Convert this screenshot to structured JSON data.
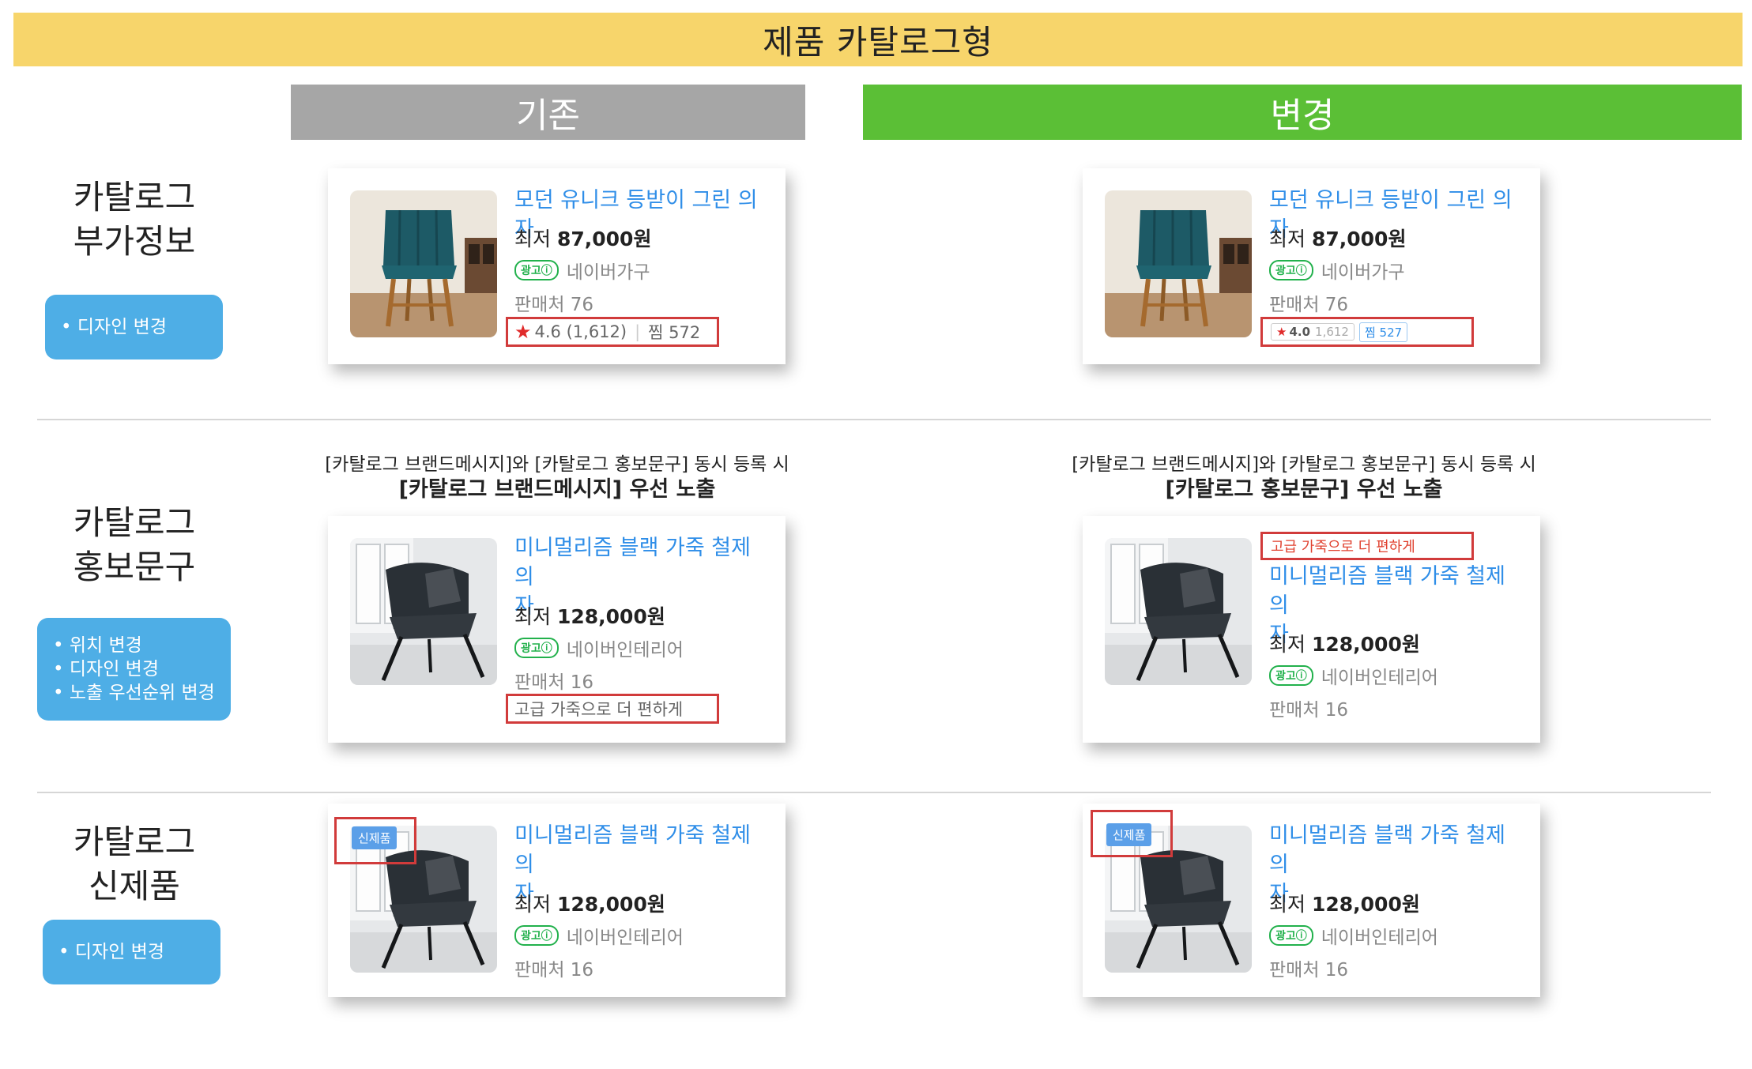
{
  "banner": "제품 카탈로그형",
  "columns": {
    "old": "기존",
    "new": "변경"
  },
  "rows": [
    {
      "title_line1": "카탈로그",
      "title_line2": "부가정보",
      "changes": [
        "디자인 변경"
      ]
    },
    {
      "title_line1": "카탈로그",
      "title_line2": "홍보문구",
      "changes": [
        "위치 변경",
        "디자인 변경",
        "노출 우선순위 변경"
      ]
    },
    {
      "title_line1": "카탈로그",
      "title_line2": "신제품",
      "changes": [
        "디자인 변경"
      ]
    }
  ],
  "notes": {
    "old_line1": "[카탈로그 브랜드메시지]와 [카탈로그 홍보문구] 동시 등록 시",
    "old_line2": "[카탈로그 브랜드메시지] 우선 노출",
    "new_line1": "[카탈로그 브랜드메시지]와 [카탈로그 홍보문구] 동시 등록 시",
    "new_line2": "[카탈로그 홍보문구] 우선 노출"
  },
  "products": {
    "chair_green": {
      "title": "모던 유니크 등받이 그린 의자",
      "price_prefix": "최저",
      "price": "87,000원",
      "ad_badge": "광고ⓘ",
      "seller": "네이버가구",
      "stores": "판매처 76",
      "rating_old": "4.6 (1,612)",
      "zzim_old": "찜 572",
      "rating_new": "4.0",
      "reviews_new": "1,612",
      "zzim_new": "찜 527"
    },
    "chair_black": {
      "title_line1": "미니멀리즘 블랙 가죽 철제 의",
      "title_line2": "자",
      "price_prefix": "최저",
      "price": "128,000원",
      "ad_badge": "광고ⓘ",
      "seller": "네이버인테리어",
      "stores": "판매처 16",
      "promo": "고급 가죽으로 더 편하게",
      "new_tag": "신제품"
    }
  },
  "colors": {
    "banner": "#f7d56b",
    "old": "#a6a6a6",
    "new": "#5bbf36",
    "link": "#2f8ee8",
    "highlight": "#d13b3b",
    "pill": "#4eaee6"
  }
}
